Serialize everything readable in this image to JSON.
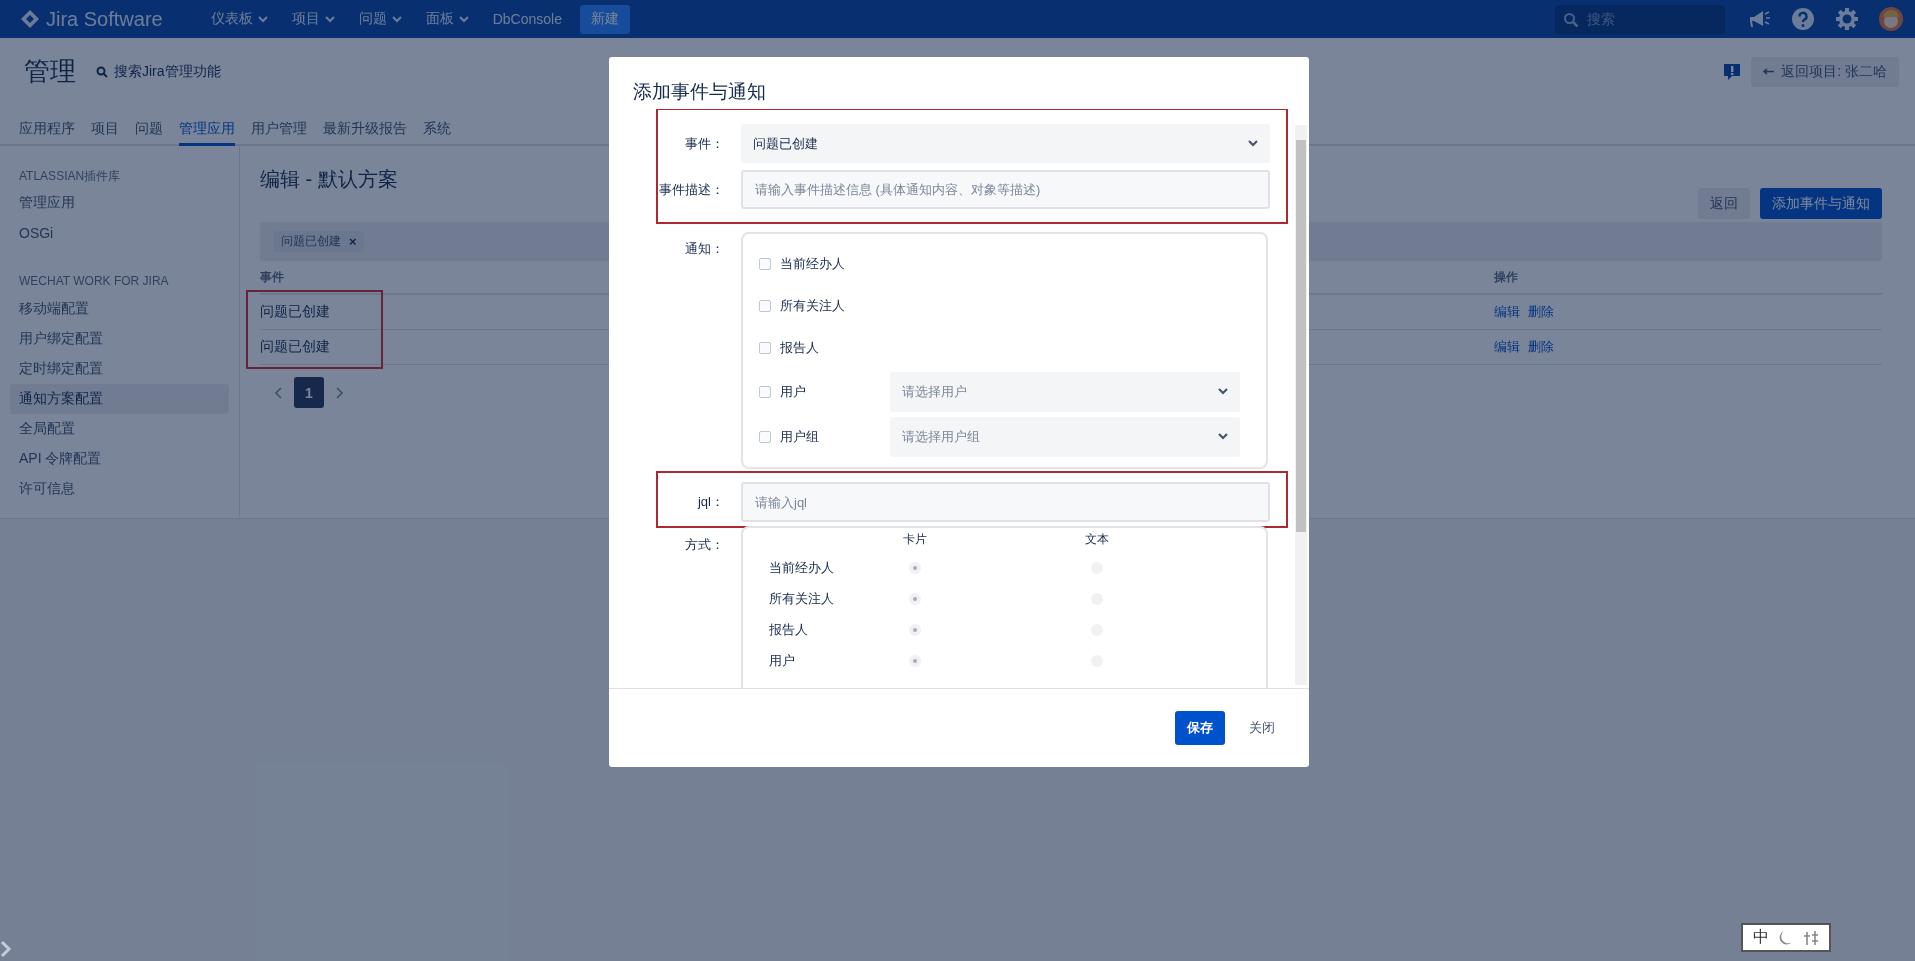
{
  "topbar": {
    "logo": "Jira Software",
    "nav": [
      {
        "label": "仪表板",
        "dropdown": true
      },
      {
        "label": "项目",
        "dropdown": true
      },
      {
        "label": "问题",
        "dropdown": true
      },
      {
        "label": "面板",
        "dropdown": true
      },
      {
        "label": "DbConsole",
        "dropdown": false
      }
    ],
    "create": "新建",
    "search": {
      "placeholder": "搜索"
    }
  },
  "header": {
    "title": "管理",
    "search_link": "搜索Jira管理功能",
    "back_button": "返回项目: 张二哈"
  },
  "tabs": [
    {
      "label": "应用程序",
      "selected": false
    },
    {
      "label": "项目",
      "selected": false
    },
    {
      "label": "问题",
      "selected": false
    },
    {
      "label": "管理应用",
      "selected": true
    },
    {
      "label": "用户管理",
      "selected": false
    },
    {
      "label": "最新升级报告",
      "selected": false
    },
    {
      "label": "系统",
      "selected": false
    }
  ],
  "sidebar": {
    "sections": [
      {
        "heading": "ATLASSIAN插件库",
        "items": [
          {
            "label": "管理应用",
            "selected": false
          },
          {
            "label": "OSGi",
            "selected": false
          }
        ]
      },
      {
        "heading": "WECHAT WORK FOR JIRA",
        "items": [
          {
            "label": "移动端配置",
            "selected": false
          },
          {
            "label": "用户绑定配置",
            "selected": false
          },
          {
            "label": "定时绑定配置",
            "selected": false
          },
          {
            "label": "通知方案配置",
            "selected": true
          },
          {
            "label": "全局配置",
            "selected": false
          },
          {
            "label": "API 令牌配置",
            "selected": false
          },
          {
            "label": "许可信息",
            "selected": false
          }
        ]
      }
    ]
  },
  "main": {
    "title": "编辑 - 默认方案",
    "buttons": [
      {
        "label": "返回",
        "kind": "secondary"
      },
      {
        "label": "添加事件与通知",
        "kind": "primary"
      }
    ],
    "filter_chips": [
      {
        "label": "问题已创建",
        "remove": "×"
      }
    ],
    "table": {
      "columns": [
        "事件",
        "操作"
      ],
      "highlighted": true,
      "rows": [
        {
          "event": "问题已创建",
          "actions": [
            "编辑",
            "删除"
          ]
        },
        {
          "event": "问题已创建",
          "actions": [
            "编辑",
            "删除"
          ]
        }
      ]
    },
    "pagination": {
      "pages": [
        {
          "label": "1",
          "selected": true
        }
      ]
    }
  },
  "modal": {
    "title": "添加事件与通知",
    "event_section": {
      "highlighted": true,
      "event": {
        "label": "事件：",
        "value": "问题已创建"
      },
      "description": {
        "label": "事件描述：",
        "placeholder": "请输入事件描述信息 (具体通知内容、对象等描述)"
      }
    },
    "notify": {
      "label": "通知：",
      "options": [
        {
          "kind": "checkbox",
          "label": "当前经办人",
          "checked": false
        },
        {
          "kind": "checkbox",
          "label": "所有关注人",
          "checked": false
        },
        {
          "kind": "checkbox",
          "label": "报告人",
          "checked": false
        },
        {
          "kind": "select",
          "label": "用户",
          "checked": false,
          "placeholder": "请选择用户"
        },
        {
          "kind": "select",
          "label": "用户组",
          "checked": false,
          "placeholder": "请选择用户组"
        }
      ]
    },
    "jql": {
      "label": "jql：",
      "placeholder": "请输入jql",
      "highlighted": true
    },
    "method": {
      "label": "方式：",
      "columns": [
        "卡片",
        "文本"
      ],
      "rows": [
        {
          "label": "当前经办人",
          "choices": [
            {
              "selected": true
            },
            {
              "selected": false
            }
          ]
        },
        {
          "label": "所有关注人",
          "choices": [
            {
              "selected": true
            },
            {
              "selected": false
            }
          ]
        },
        {
          "label": "报告人",
          "choices": [
            {
              "selected": true
            },
            {
              "selected": false
            }
          ]
        },
        {
          "label": "用户",
          "choices": [
            {
              "selected": true
            },
            {
              "selected": false
            }
          ]
        }
      ]
    },
    "buttons": [
      {
        "label": "保存",
        "kind": "primary"
      },
      {
        "label": "关闭",
        "kind": "link"
      }
    ]
  },
  "ime": {
    "mode": "中"
  }
}
